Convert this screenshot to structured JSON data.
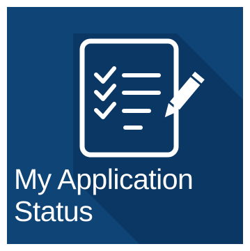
{
  "tile": {
    "title_line1": "My Application",
    "title_line2": "Status",
    "icon": "clipboard-checklist-pencil-icon",
    "background_color": "#0f4476",
    "shadow_color": "#0a3764",
    "foreground_color": "#ffffff"
  }
}
